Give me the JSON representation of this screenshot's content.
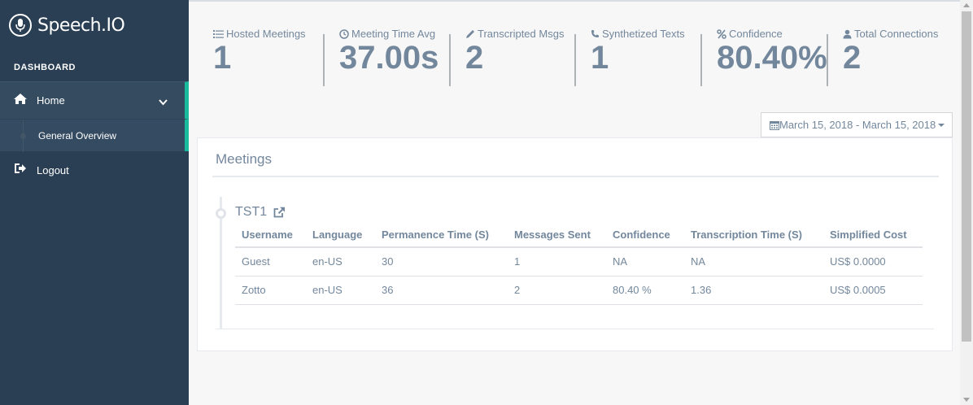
{
  "brand": {
    "name": "Speech.IO",
    "icon": "microphone-icon"
  },
  "sidebar": {
    "section_title": "DASHBOARD",
    "items": [
      {
        "label": "Home",
        "icon": "home-icon"
      },
      {
        "label": "General Overview"
      },
      {
        "label": "Logout",
        "icon": "logout-icon"
      }
    ]
  },
  "stats": [
    {
      "label": "Hosted Meetings",
      "value": "1",
      "icon": "list-icon"
    },
    {
      "label": "Meeting Time Avg",
      "value": "37.00s",
      "icon": "clock-icon"
    },
    {
      "label": "Transcripted Msgs",
      "value": "2",
      "icon": "pencil-icon"
    },
    {
      "label": "Synthetized Texts",
      "value": "1",
      "icon": "phone-icon"
    },
    {
      "label": "Confidence",
      "value": "80.40%",
      "icon": "percent-icon"
    },
    {
      "label": "Total Connections",
      "value": "2",
      "icon": "user-icon"
    }
  ],
  "date_range": {
    "label": "March 15, 2018 - March 15, 2018",
    "icon": "calendar-icon"
  },
  "panel": {
    "title": "Meetings",
    "meeting": {
      "name": "TST1",
      "columns": [
        "Username",
        "Language",
        "Permanence Time (S)",
        "Messages Sent",
        "Confidence",
        "Transcription Time (S)",
        "Simplified Cost"
      ],
      "rows": [
        [
          "Guest",
          "en-US",
          "30",
          "1",
          "NA",
          "NA",
          "US$ 0.0000"
        ],
        [
          "Zotto",
          "en-US",
          "36",
          "2",
          "80.40 %",
          "1.36",
          "US$ 0.0005"
        ]
      ]
    }
  },
  "colors": {
    "sidebar_bg": "#2a3f54",
    "accent": "#1abb9c",
    "text": "#73879c"
  }
}
